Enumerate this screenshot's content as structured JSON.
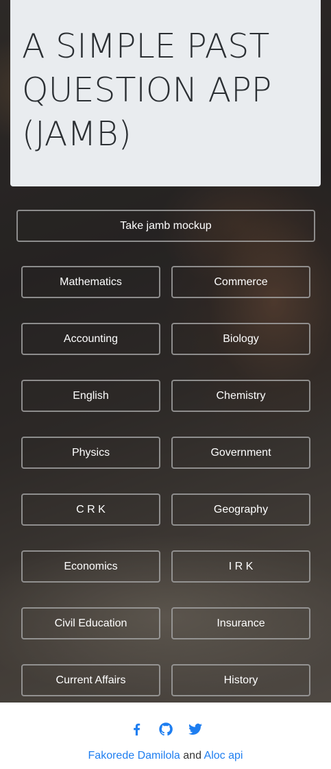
{
  "header": {
    "title": "A SIMPLE PAST\nQUESTION APP\n(JAMB)"
  },
  "mockup_button": "Take jamb mockup",
  "subjects": [
    "Mathematics",
    "Commerce",
    "Accounting",
    "Biology",
    "English",
    "Chemistry",
    "Physics",
    "Government",
    "C R K",
    "Geography",
    "Economics",
    "I R K",
    "Civil Education",
    "Insurance",
    "Current Affairs",
    "History"
  ],
  "footer": {
    "author": "Fakorede Damilola",
    "and": "and",
    "api": "Aloc api",
    "icons": [
      "facebook-icon",
      "github-icon",
      "twitter-icon"
    ]
  },
  "colors": {
    "link": "#1e7ef0",
    "title_card": "#e9ecef"
  }
}
